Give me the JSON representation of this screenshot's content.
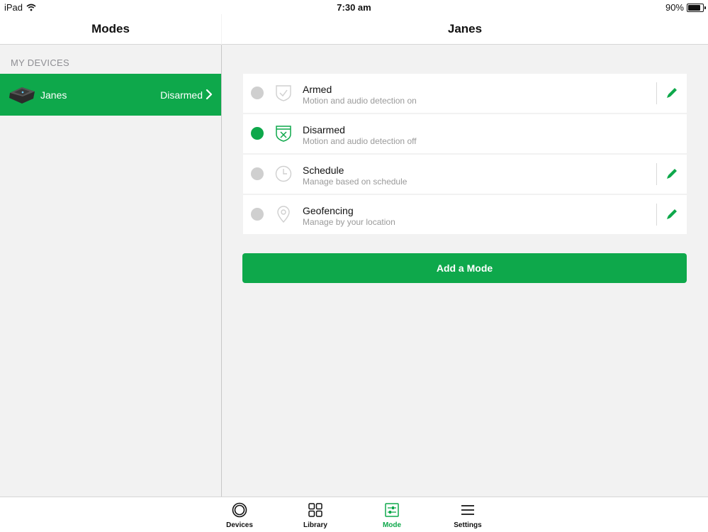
{
  "status_bar": {
    "device": "iPad",
    "time": "7:30 am",
    "battery": "90%",
    "battery_level": 0.9
  },
  "sidebar": {
    "title": "Modes",
    "section_label": "MY DEVICES",
    "devices": [
      {
        "name": "Janes",
        "status": "Disarmed"
      }
    ]
  },
  "main": {
    "title": "Janes",
    "modes": [
      {
        "title": "Armed",
        "subtitle": "Motion and audio detection on",
        "icon": "shield-check-icon",
        "active": false,
        "editable": true
      },
      {
        "title": "Disarmed",
        "subtitle": "Motion and audio detection off",
        "icon": "shield-x-icon",
        "active": true,
        "editable": false
      },
      {
        "title": "Schedule",
        "subtitle": "Manage based on schedule",
        "icon": "clock-icon",
        "active": false,
        "editable": true
      },
      {
        "title": "Geofencing",
        "subtitle": "Manage by your location",
        "icon": "location-pin-icon",
        "active": false,
        "editable": true
      }
    ],
    "add_button_label": "Add a Mode"
  },
  "tab_bar": {
    "tabs": [
      {
        "label": "Devices",
        "icon": "devices-icon",
        "active": false
      },
      {
        "label": "Library",
        "icon": "library-grid-icon",
        "active": false
      },
      {
        "label": "Mode",
        "icon": "mode-sliders-icon",
        "active": true
      },
      {
        "label": "Settings",
        "icon": "settings-menu-icon",
        "active": false
      }
    ]
  },
  "colors": {
    "accent": "#0ea84b",
    "inactive_dot": "#cfcfcf",
    "inactive_icon": "#c8c8c8"
  }
}
